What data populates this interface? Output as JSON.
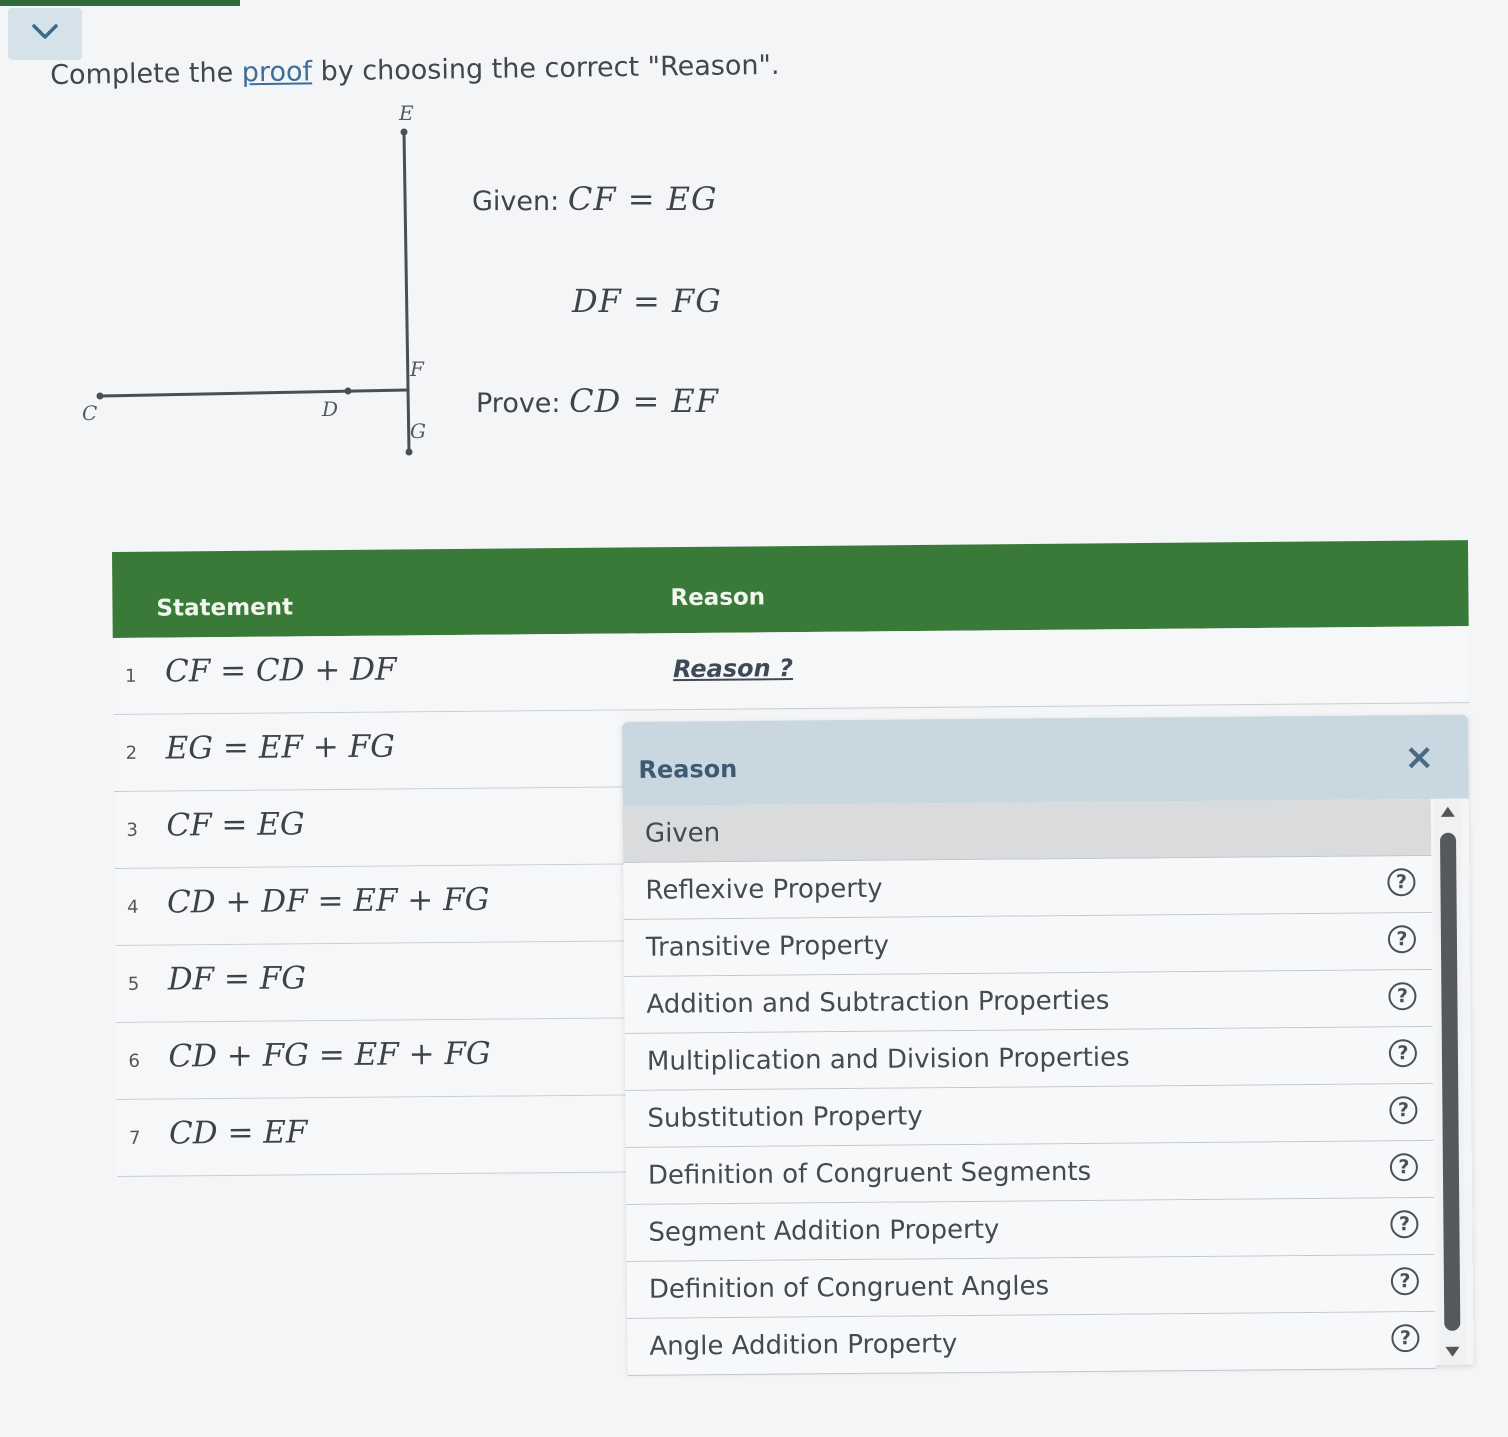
{
  "instruction": {
    "prefix": "Complete the ",
    "link": "proof",
    "suffix": " by choosing the correct \"Reason\"."
  },
  "diagram": {
    "labels": {
      "E": "E",
      "F": "F",
      "G": "G",
      "C": "C",
      "D": "D"
    }
  },
  "given": {
    "given_label": "Given:",
    "given_1": "CF = EG",
    "given_2": "DF = FG",
    "prove_label": "Prove:",
    "prove": "CD = EF"
  },
  "table": {
    "header_statement": "Statement",
    "header_reason": "Reason",
    "rows": [
      {
        "num": "1",
        "statement": "CF = CD + DF",
        "reason": "Reason ?"
      },
      {
        "num": "2",
        "statement": "EG = EF + FG"
      },
      {
        "num": "3",
        "statement": "CF = EG"
      },
      {
        "num": "4",
        "statement": "CD + DF = EF + FG"
      },
      {
        "num": "5",
        "statement": "DF = FG"
      },
      {
        "num": "6",
        "statement": "CD + FG = EF + FG"
      },
      {
        "num": "7",
        "statement": "CD = EF"
      }
    ]
  },
  "popup": {
    "title": "Reason",
    "close": "×",
    "help": "?",
    "options": [
      "Given",
      "Reflexive Property",
      "Transitive Property",
      "Addition and Subtraction Properties",
      "Multiplication and Division Properties",
      "Substitution Property",
      "Definition of Congruent Segments",
      "Segment Addition Property",
      "Definition of Congruent Angles",
      "Angle Addition Property"
    ],
    "selected_index": 0
  },
  "colors": {
    "header_green": "#3a7a38",
    "popup_header": "#c9d8e0",
    "link_blue": "#3d6e9c"
  }
}
